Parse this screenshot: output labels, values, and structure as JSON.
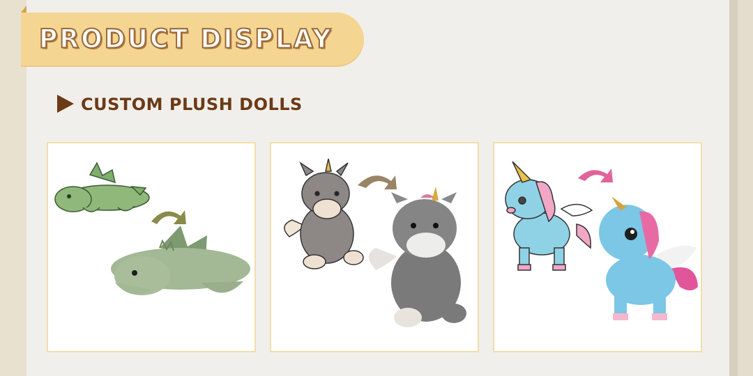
{
  "header": {
    "title": "PRODUCT DISPLAY"
  },
  "section": {
    "label": "CUSTOM PLUSH DOLLS",
    "bullet_icon": "play-triangle-icon"
  },
  "colors": {
    "banner": "#f5d592",
    "heading": "#6b3a16",
    "card_border": "#f1dfa9",
    "page": "#f1efeb"
  },
  "cards": [
    {
      "subject": "dragon",
      "sketch_color": "#8fb87a",
      "plush_color": "#a3b895",
      "arrow_color": "#8a8a4a"
    },
    {
      "subject": "donkey-unicorn",
      "sketch_color": "#8d8886",
      "plush_color": "#7a7a7a",
      "arrow_color": "#9a8467"
    },
    {
      "subject": "unicorn",
      "sketch_color": "#8fd2e6",
      "plush_color": "#7cc6e6",
      "arrow_color": "#e0649a"
    }
  ]
}
